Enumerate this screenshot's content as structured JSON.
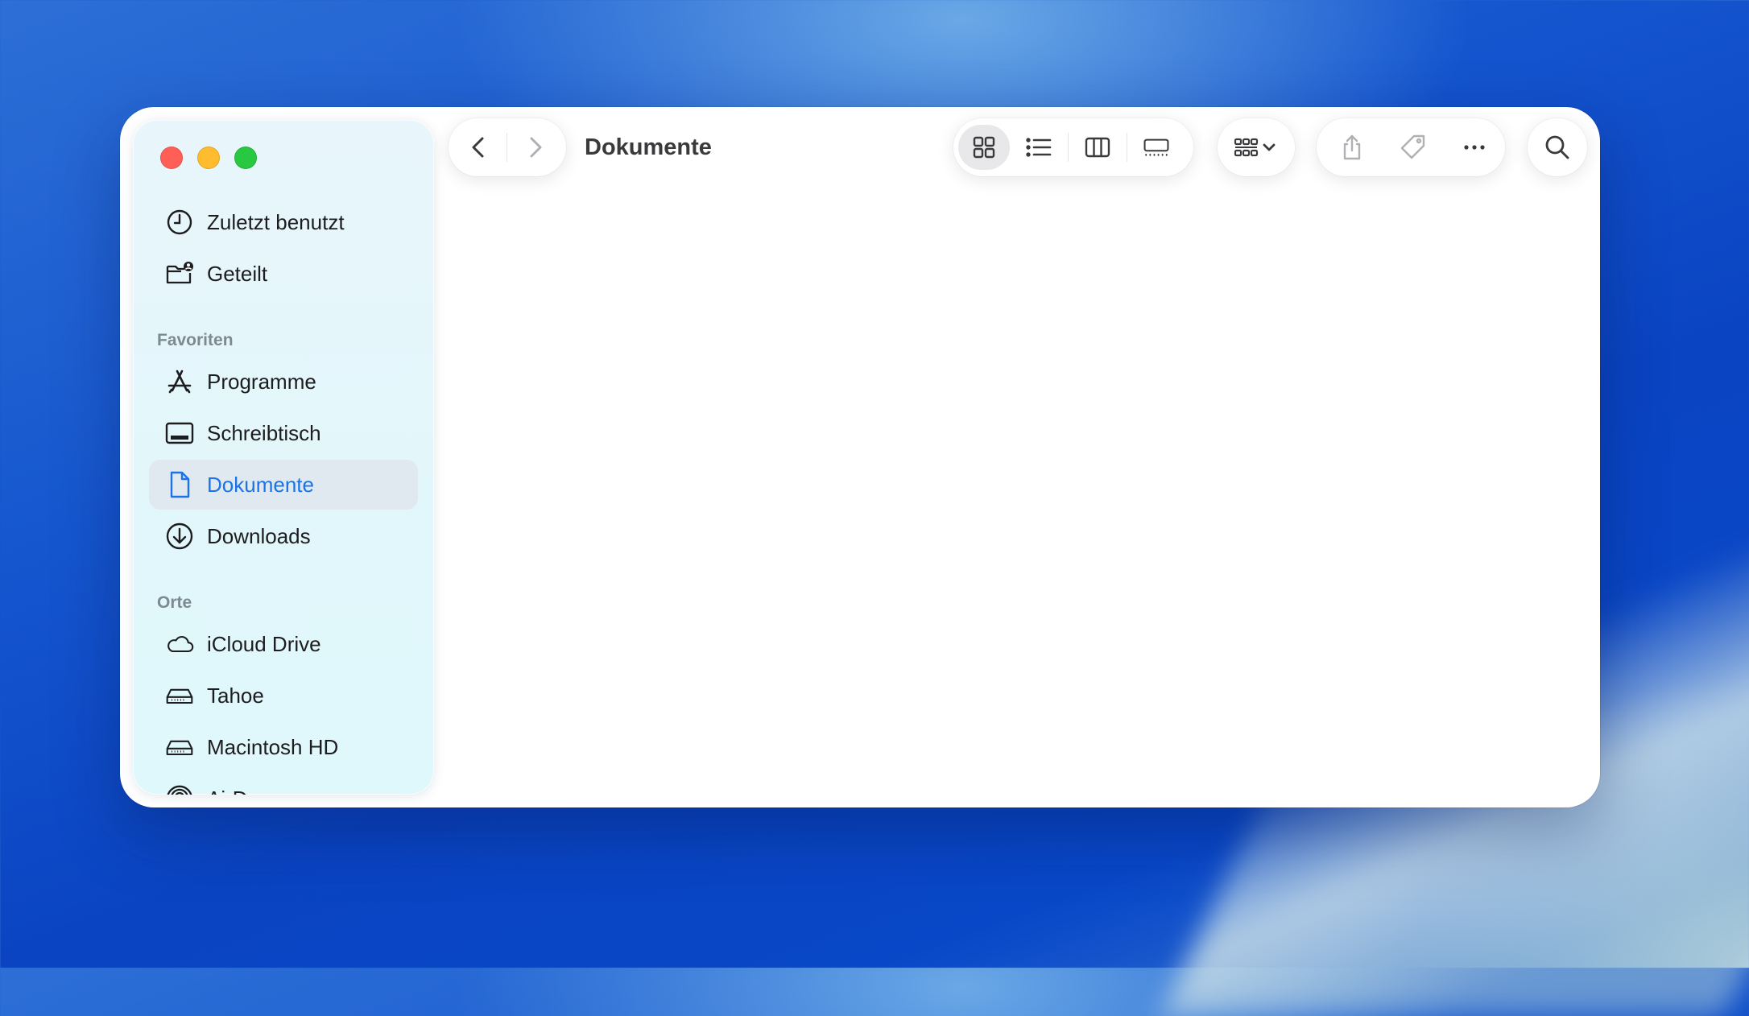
{
  "window": {
    "title": "Dokumente"
  },
  "sidebar": {
    "top_items": [
      {
        "label": "Zuletzt benutzt",
        "icon": "clock-icon"
      },
      {
        "label": "Geteilt",
        "icon": "shared-folder-icon"
      }
    ],
    "favorites": {
      "header": "Favoriten",
      "items": [
        {
          "label": "Programme",
          "icon": "applications-icon"
        },
        {
          "label": "Schreibtisch",
          "icon": "desktop-icon"
        },
        {
          "label": "Dokumente",
          "icon": "document-icon",
          "selected": true
        },
        {
          "label": "Downloads",
          "icon": "download-icon"
        }
      ]
    },
    "locations": {
      "header": "Orte",
      "items": [
        {
          "label": "iCloud Drive",
          "icon": "cloud-icon"
        },
        {
          "label": "Tahoe",
          "icon": "drive-icon"
        },
        {
          "label": "Macintosh HD",
          "icon": "drive-icon"
        },
        {
          "label": "AirDrop",
          "icon": "airdrop-icon"
        }
      ]
    }
  },
  "toolbar": {
    "navigation": [
      "back-icon",
      "forward-icon"
    ],
    "view_modes": [
      "icon-view-icon",
      "list-view-icon",
      "column-view-icon",
      "gallery-view-icon"
    ],
    "selected_view": "icon-view-icon",
    "group_menu": "group-icon",
    "actions": [
      "share-icon",
      "tag-icon",
      "more-icon"
    ],
    "search": "search-icon"
  },
  "colors": {
    "accent": "#1a73e8",
    "close": "#ff5f57",
    "minimize": "#febc2e",
    "zoom": "#28c840"
  }
}
